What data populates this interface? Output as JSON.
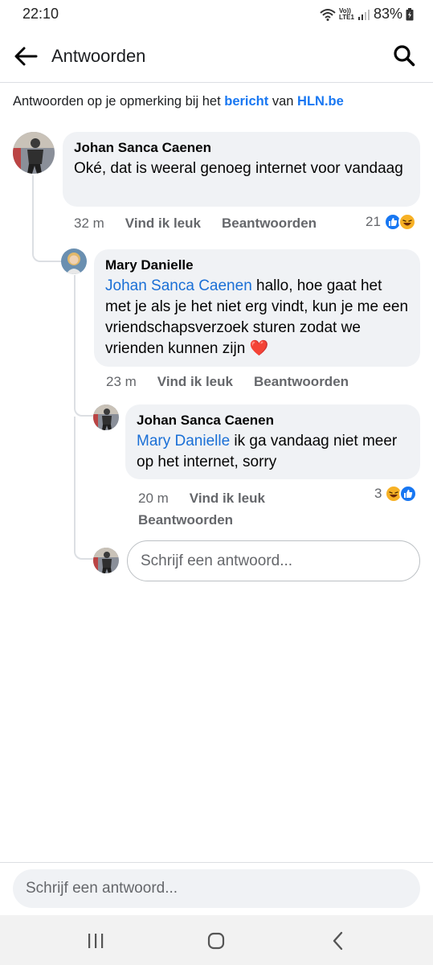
{
  "status_bar": {
    "time": "22:10",
    "battery": "83%",
    "network_label": "LTE1",
    "volte_label": "Vo))"
  },
  "header": {
    "title": "Antwoorden",
    "back_icon": "arrow-left-icon",
    "search_icon": "search-icon"
  },
  "context": {
    "prefix": "Antwoorden op je opmerking bij het ",
    "post_link": "bericht",
    "middle": " van ",
    "page_link": "HLN.be"
  },
  "comments": [
    {
      "author": "Johan Sanca Caenen",
      "text": "Oké, dat is weeral genoeg internet voor vandaag",
      "time": "32 m",
      "like_label": "Vind ik leuk",
      "reply_label": "Beantwoorden",
      "reaction_count": "21",
      "reactions": [
        "like-icon",
        "haha-icon"
      ]
    },
    {
      "author": "Mary Danielle",
      "mention": "Johan Sanca Caenen",
      "text": " hallo, hoe gaat het met je als je het niet erg vindt, kun je me een vriendschapsverzoek sturen zodat we vrienden kunnen zijn ",
      "emoji": "❤️",
      "time": "23 m",
      "like_label": "Vind ik leuk",
      "reply_label": "Beantwoorden"
    },
    {
      "author": "Johan Sanca Caenen",
      "mention": "Mary Danielle",
      "text": " ik ga vandaag niet meer op het internet, sorry",
      "time": "20 m",
      "like_label": "Vind ik leuk",
      "reply_label": "Beantwoorden",
      "reaction_count": "3",
      "reactions": [
        "haha-icon",
        "like-icon"
      ]
    }
  ],
  "reply_placeholder": "Schrijf een antwoord...",
  "bottom_placeholder": "Schrijf een antwoord...",
  "nav": {
    "recents_icon": "recents-icon",
    "home_icon": "home-icon",
    "back_icon": "back-chevron-icon"
  },
  "colors": {
    "accent": "#1877f2",
    "bubble": "#f0f2f5",
    "secondary_text": "#65676b",
    "like": "#1877f2",
    "haha": "#f7b125"
  }
}
